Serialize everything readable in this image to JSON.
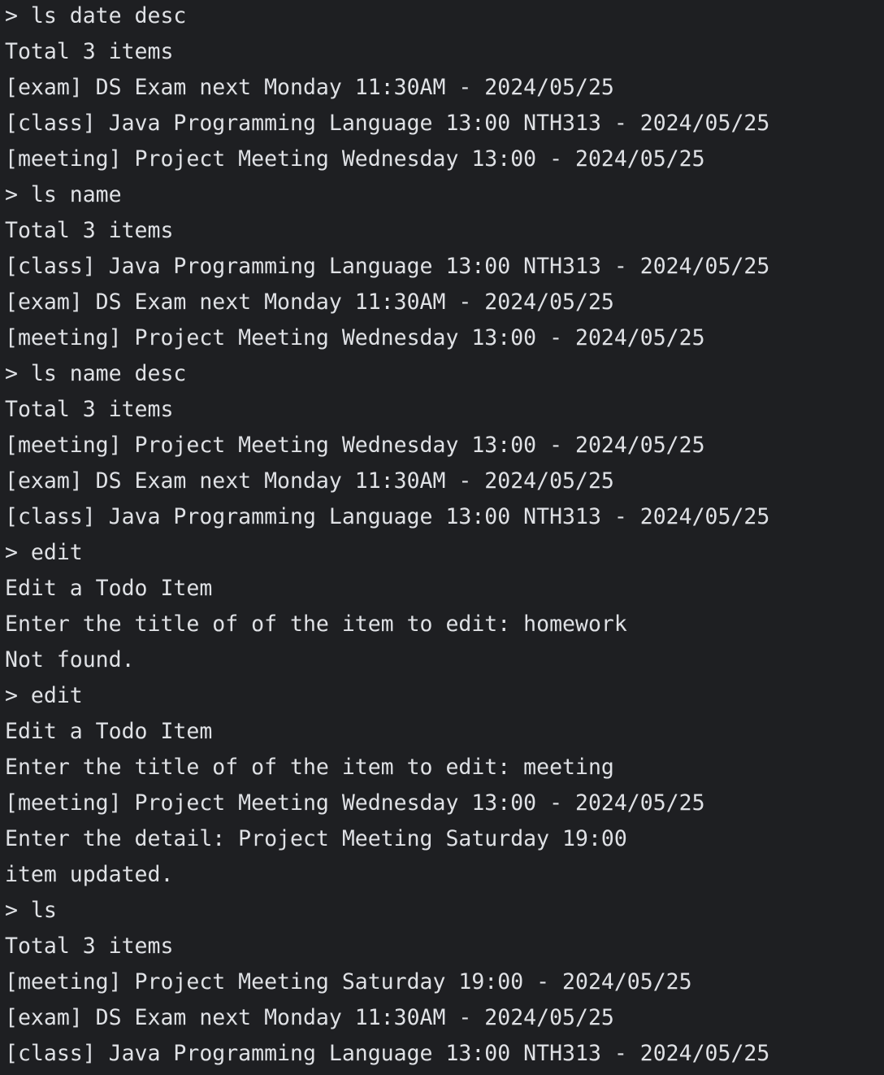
{
  "terminal": {
    "lines": [
      "> ls date desc",
      "Total 3 items",
      "[exam] DS Exam next Monday 11:30AM - 2024/05/25",
      "[class] Java Programming Language 13:00 NTH313 - 2024/05/25",
      "[meeting] Project Meeting Wednesday 13:00 - 2024/05/25",
      "> ls name",
      "Total 3 items",
      "[class] Java Programming Language 13:00 NTH313 - 2024/05/25",
      "[exam] DS Exam next Monday 11:30AM - 2024/05/25",
      "[meeting] Project Meeting Wednesday 13:00 - 2024/05/25",
      "> ls name desc",
      "Total 3 items",
      "[meeting] Project Meeting Wednesday 13:00 - 2024/05/25",
      "[exam] DS Exam next Monday 11:30AM - 2024/05/25",
      "[class] Java Programming Language 13:00 NTH313 - 2024/05/25",
      "> edit",
      "Edit a Todo Item",
      "Enter the title of of the item to edit: homework",
      "Not found.",
      "> edit",
      "Edit a Todo Item",
      "Enter the title of of the item to edit: meeting",
      "[meeting] Project Meeting Wednesday 13:00 - 2024/05/25",
      "Enter the detail: Project Meeting Saturday 19:00",
      "item updated.",
      "> ls",
      "Total 3 items",
      "[meeting] Project Meeting Saturday 19:00 - 2024/05/25",
      "[exam] DS Exam next Monday 11:30AM - 2024/05/25",
      "[class] Java Programming Language 13:00 NTH313 - 2024/05/25"
    ]
  },
  "colors": {
    "background": "#1e1f22",
    "text": "#dfe1e5"
  }
}
